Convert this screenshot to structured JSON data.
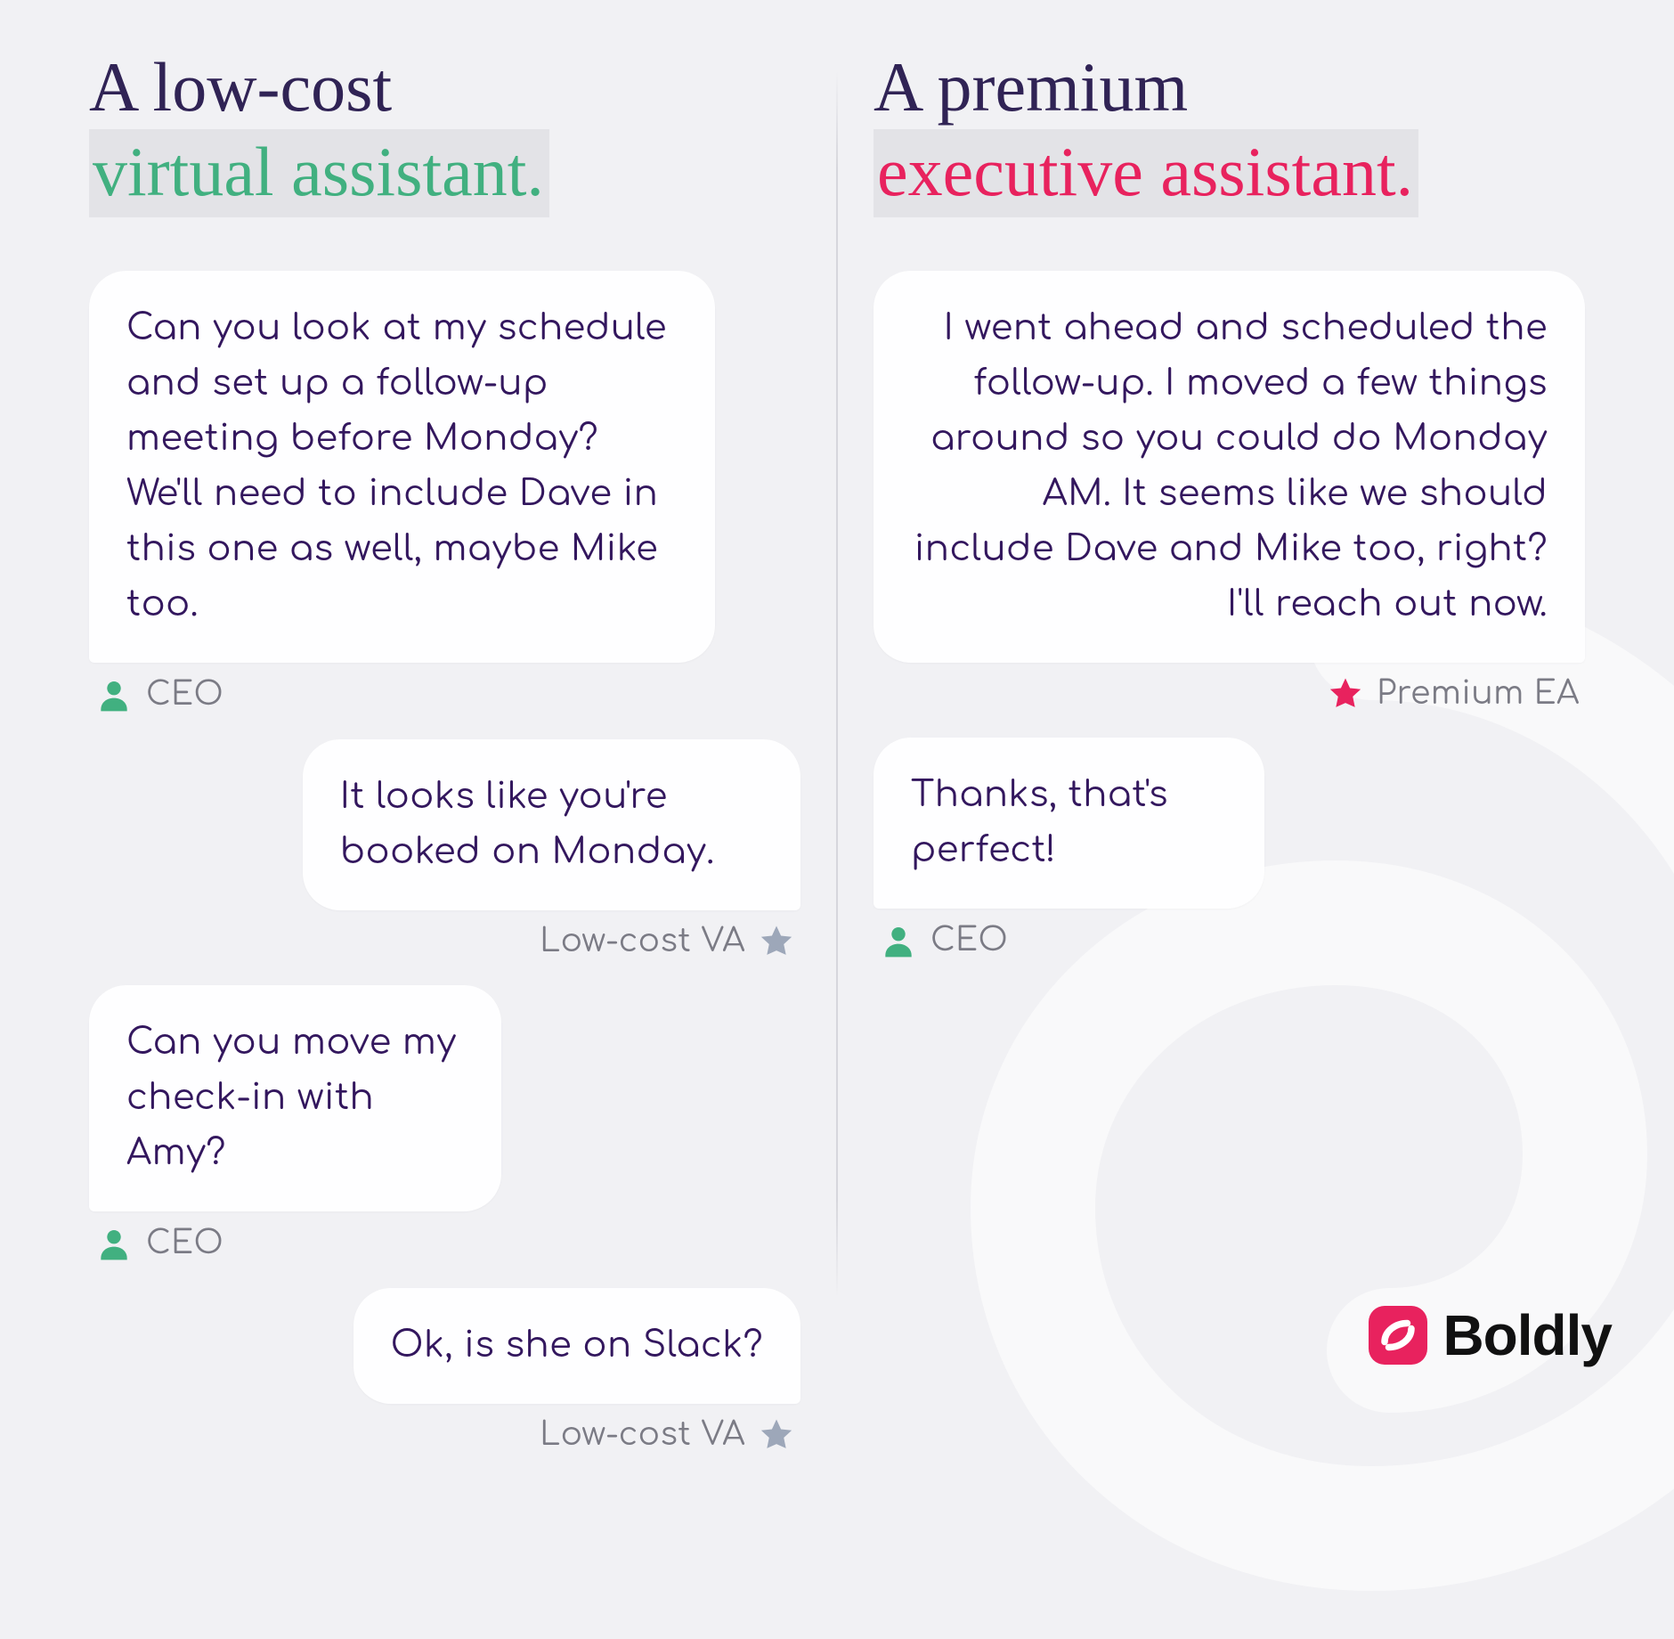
{
  "left": {
    "heading_line1": "A low-cost",
    "heading_line2": "virtual assistant.",
    "messages": [
      {
        "side": "left",
        "who": "CEO",
        "who_icon": "person",
        "text": "Can you look at my schedule and set up a follow-up meeting before Monday? We'll need to include Dave in this one as well, maybe Mike too."
      },
      {
        "side": "right",
        "who": "Low-cost VA",
        "who_icon": "star",
        "text": "It looks like you're booked on Monday."
      },
      {
        "side": "left",
        "who": "CEO",
        "who_icon": "person",
        "text": "Can you move my check-in with Amy?"
      },
      {
        "side": "right",
        "who": "Low-cost VA",
        "who_icon": "star",
        "text": "Ok, is she on Slack?"
      }
    ]
  },
  "right": {
    "heading_line1": "A premium",
    "heading_line2": "executive assistant.",
    "messages": [
      {
        "side": "right",
        "who": "Premium EA",
        "who_icon": "star-pink",
        "text": "I went ahead and scheduled the follow-up. I moved a few things around so you could do Monday AM. It seems like we should include Dave and Mike too, right? I'll reach out now."
      },
      {
        "side": "left",
        "who": "CEO",
        "who_icon": "person",
        "text": "Thanks, that's perfect!"
      }
    ]
  },
  "brand": {
    "name": "Boldly"
  },
  "colors": {
    "green": "#41b080",
    "pink": "#e8225e",
    "text": "#33175e",
    "bg": "#f1f1f4"
  }
}
